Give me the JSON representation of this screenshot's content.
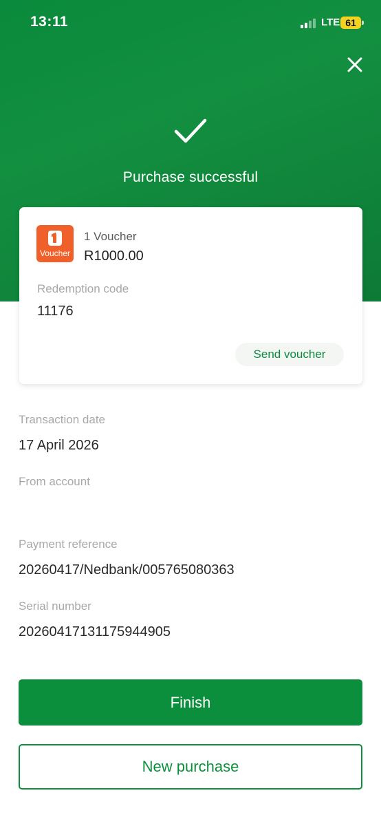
{
  "status_bar": {
    "time": "13:11",
    "network": "LTE",
    "battery": "61"
  },
  "colors": {
    "primary": "#0c8f3d",
    "voucher_brand": "#f0602a",
    "battery": "#f4d21f"
  },
  "header": {
    "close_icon": "close-icon",
    "check_icon": "check-icon",
    "title": "Purchase successful"
  },
  "voucher": {
    "logo_text": "Voucher",
    "name": "1 Voucher",
    "amount": "R1000.00",
    "code_label": "Redemption code",
    "code_value": "11176",
    "send_label": "Send voucher"
  },
  "details": {
    "transaction_date_label": "Transaction date",
    "transaction_date": "17 April 2026",
    "from_account_label": "From account",
    "from_account": "",
    "payment_reference_label": "Payment reference",
    "payment_reference": "20260417/Nedbank/005765080363",
    "serial_number_label": "Serial number",
    "serial_number": "20260417131175944905"
  },
  "actions": {
    "finish_label": "Finish",
    "new_purchase_label": "New purchase"
  }
}
